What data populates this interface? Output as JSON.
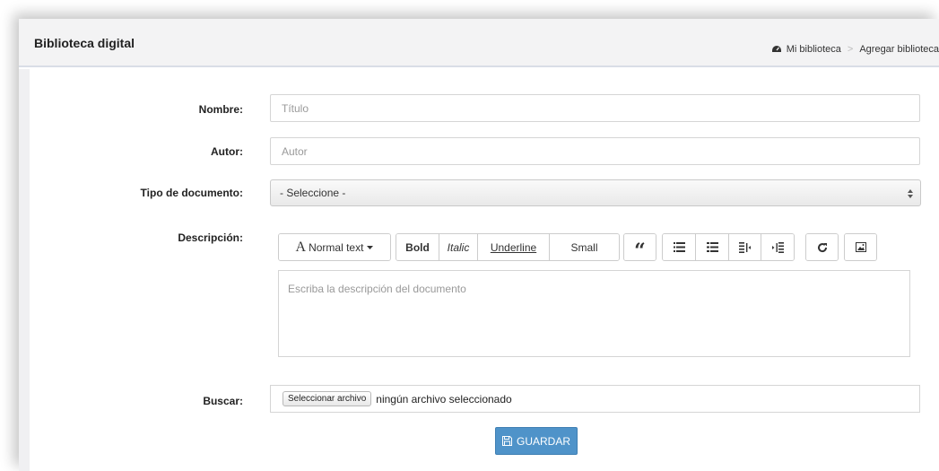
{
  "header": {
    "title": "Biblioteca digital",
    "breadcrumb": {
      "home_icon": "dashboard-icon",
      "home": "Mi biblioteca",
      "separator": ">",
      "current": "Agregar biblioteca"
    }
  },
  "form": {
    "nombre": {
      "label": "Nombre:",
      "placeholder": "Título"
    },
    "autor": {
      "label": "Autor:",
      "placeholder": "Autor"
    },
    "tipo": {
      "label": "Tipo de documento:",
      "selected": "- Seleccione -"
    },
    "descripcion": {
      "label": "Descripción:",
      "placeholder": "Escriba la descripción del documento",
      "toolbar": {
        "text_style": "Normal text",
        "text_style_glyph": "A",
        "bold": "Bold",
        "italic": "Italic",
        "underline": "Underline",
        "small": "Small",
        "blockquote": "“",
        "icons": [
          "quote-icon",
          "unordered-list-icon",
          "ordered-list-icon",
          "outdent-icon",
          "indent-icon",
          "link-icon",
          "image-icon"
        ]
      }
    },
    "buscar": {
      "label": "Buscar:",
      "button": "Seleccionar archivo",
      "status": "ningún archivo seleccionado"
    },
    "save": {
      "label": "GUARDAR",
      "icon": "floppy-disk-icon"
    }
  },
  "colors": {
    "header_bg": "#f3f3f4",
    "primary": "#4f93c9",
    "border": "#d5d5d5"
  }
}
